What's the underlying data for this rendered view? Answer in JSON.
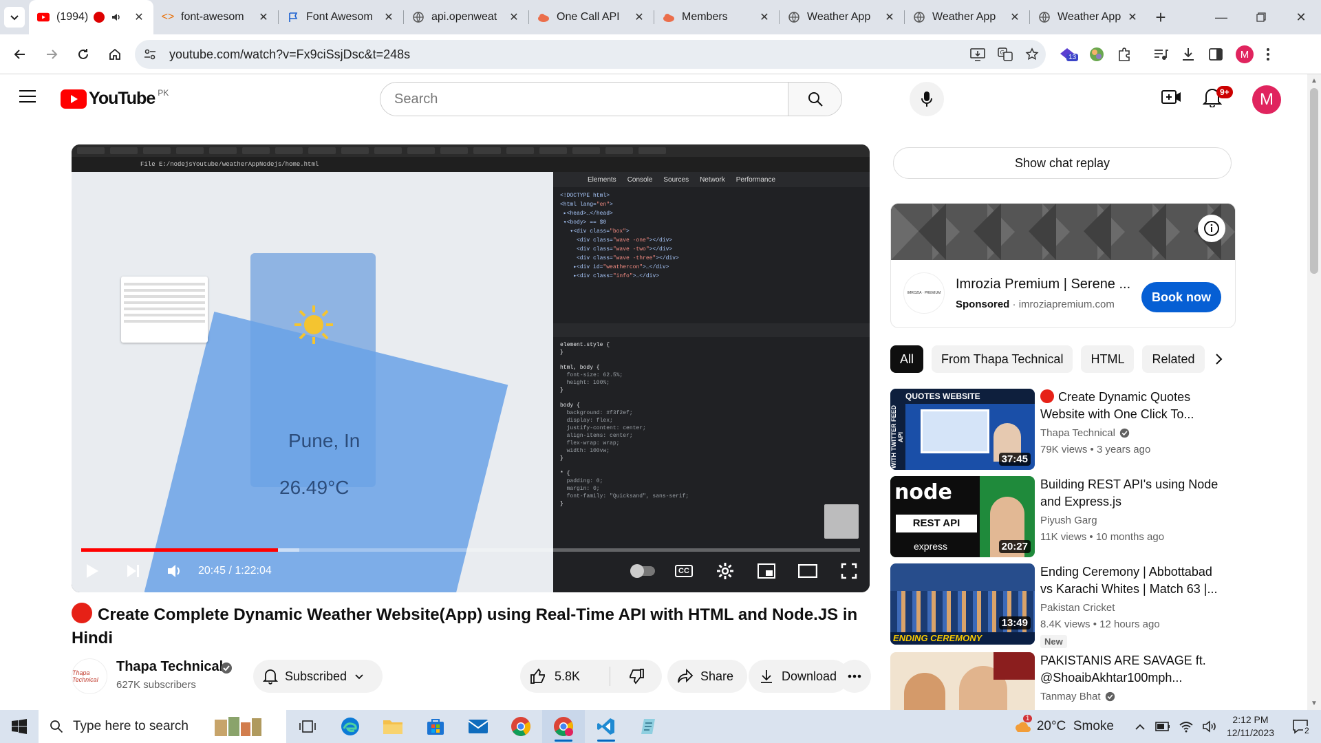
{
  "browser": {
    "tabs": [
      {
        "title": "(1994)",
        "active": true
      },
      {
        "title": "font-awesom"
      },
      {
        "title": "Font Awesom"
      },
      {
        "title": "api.openweat"
      },
      {
        "title": "One Call API"
      },
      {
        "title": "Members"
      },
      {
        "title": "Weather App"
      },
      {
        "title": "Weather App"
      },
      {
        "title": "Weather App"
      }
    ],
    "url": "youtube.com/watch?v=Fx9ciSsjDsc&t=248s",
    "extension_badge": "13",
    "profile_initial": "M"
  },
  "youtube": {
    "logo_text": "YouTube",
    "country": "PK",
    "search_placeholder": "Search",
    "notifications": "9+",
    "avatar_initial": "M"
  },
  "player": {
    "embedded": {
      "address": "File  E:/nodejsYoutube/weatherAppNodejs/home.html",
      "city": "Pune, In",
      "temperature": "26.49°C",
      "devtools_tabs": [
        "Elements",
        "Console",
        "Sources",
        "Network",
        "Performance"
      ]
    },
    "time_current": "20:45",
    "time_total": "1:22:04",
    "progress_fraction": 0.2528,
    "cc_label": "CC"
  },
  "video": {
    "title": "Create Complete Dynamic Weather Website(App) using Real-Time API with HTML and Node.JS in Hindi",
    "channel": "Thapa Technical",
    "channel_avatar_text": "Thapa Technical",
    "subscribers": "627K subscribers",
    "subscribed_label": "Subscribed",
    "likes": "5.8K",
    "share_label": "Share",
    "download_label": "Download"
  },
  "sidebar": {
    "chat_replay": "Show chat replay",
    "ad": {
      "title": "Imrozia Premium | Serene ...",
      "sponsored": "Sponsored",
      "domain": "imroziapremium.com",
      "cta": "Book now",
      "logo_text": "IMROZIA · PREMIUM"
    },
    "chips": [
      "All",
      "From Thapa Technical",
      "HTML",
      "Related"
    ],
    "recommendations": [
      {
        "title": "Create Dynamic Quotes Website with One Click To...",
        "live_dot": true,
        "channel": "Thapa Technical",
        "verified": true,
        "meta": "79K views  • 3 years ago",
        "duration": "37:45",
        "thumb_text": "QUOTES WEBSITE",
        "thumb_side": "WITH TWITTER FEED API"
      },
      {
        "title": "Building REST API's using Node and Express.js",
        "channel": "Piyush Garg",
        "meta": "11K views  • 10 months ago",
        "duration": "20:27",
        "thumb_text": "REST API",
        "thumb_brand": "node",
        "thumb_sub": "express"
      },
      {
        "title": "Ending Ceremony | Abbottabad vs Karachi Whites | Match 63 |...",
        "channel": "Pakistan Cricket",
        "meta": "8.4K views  • 12 hours ago",
        "duration": "13:49",
        "badge": "New",
        "thumb_text": "ENDING CEREMONY"
      },
      {
        "title": "PAKISTANIS ARE SAVAGE ft. @ShoaibAkhtar100mph...",
        "channel": "Tanmay Bhat",
        "verified": true,
        "meta": "",
        "duration": ""
      }
    ]
  },
  "taskbar": {
    "search_placeholder": "Type here to search",
    "weather": "20°C  Smoke",
    "weather_badge": "1",
    "time": "2:12 PM",
    "date": "12/11/2023",
    "notification_count": "2"
  },
  "colors": {
    "youtube_red": "#ff0000",
    "book_now": "#065fd4",
    "avatar": "#e0245e"
  }
}
